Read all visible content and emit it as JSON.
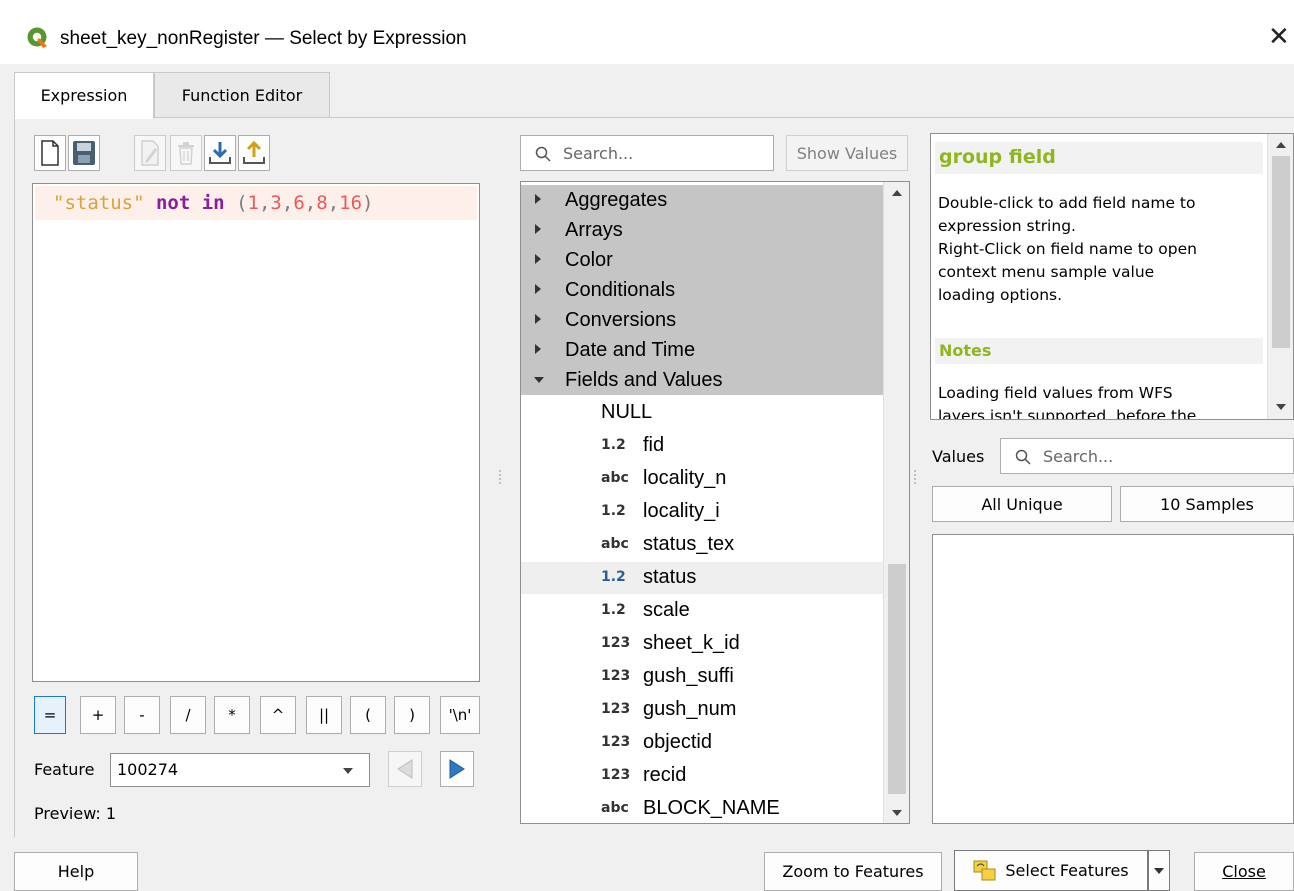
{
  "window": {
    "title": "sheet_key_nonRegister — Select by Expression",
    "close_glyph": "✕"
  },
  "tabs": [
    {
      "label": "Expression",
      "active": true
    },
    {
      "label": "Function Editor",
      "active": false
    }
  ],
  "toolbar": {
    "icons": [
      "new-file-icon",
      "save-icon",
      "edit-icon",
      "delete-icon",
      "import-icon",
      "export-icon"
    ]
  },
  "editor": {
    "expression": {
      "field": "\"status\"",
      "keyword": "not in",
      "paren_open": "(",
      "values": [
        "1",
        "3",
        "6",
        "8",
        "16"
      ],
      "comma": ",",
      "paren_close": ")"
    }
  },
  "operators": [
    "=",
    "+",
    "-",
    "/",
    "*",
    "^",
    "||",
    "(",
    ")",
    "'\\n'"
  ],
  "feature": {
    "label": "Feature",
    "value": "100274"
  },
  "preview": {
    "text": "Preview: 1"
  },
  "search": {
    "placeholder": "Search...",
    "show_values_label": "Show Values"
  },
  "function_tree": {
    "groups": [
      {
        "label": "Aggregates",
        "expanded": false
      },
      {
        "label": "Arrays",
        "expanded": false
      },
      {
        "label": "Color",
        "expanded": false
      },
      {
        "label": "Conditionals",
        "expanded": false
      },
      {
        "label": "Conversions",
        "expanded": false
      },
      {
        "label": "Date and Time",
        "expanded": false
      },
      {
        "label": "Fields and Values",
        "expanded": true
      }
    ],
    "fields": [
      {
        "type": "",
        "name": "NULL"
      },
      {
        "type": "1.2",
        "name": "fid"
      },
      {
        "type": "abc",
        "name": "locality_n"
      },
      {
        "type": "1.2",
        "name": "locality_i"
      },
      {
        "type": "abc",
        "name": "status_tex"
      },
      {
        "type": "1.2",
        "name": "status",
        "selected": true
      },
      {
        "type": "1.2",
        "name": "scale"
      },
      {
        "type": "123",
        "name": "sheet_k_id"
      },
      {
        "type": "123",
        "name": "gush_suffi"
      },
      {
        "type": "123",
        "name": "gush_num"
      },
      {
        "type": "123",
        "name": "objectid"
      },
      {
        "type": "123",
        "name": "recid"
      },
      {
        "type": "abc",
        "name": "BLOCK_NAME"
      }
    ]
  },
  "help": {
    "title": "group field",
    "body": [
      "Double-click to add field name to",
      "expression string.",
      "Right-Click on field name to open",
      "context menu sample value",
      "loading options."
    ],
    "notes_heading": "Notes",
    "notes_body": [
      "Loading field values from WFS",
      "layers isn't supported, before the"
    ]
  },
  "values": {
    "label": "Values",
    "search_placeholder": "Search...",
    "all_unique_label": "All Unique",
    "samples_label": "10 Samples"
  },
  "footer": {
    "help_label": "Help",
    "zoom_label": "Zoom to Features",
    "select_label": "Select Features",
    "close_label": "Close"
  },
  "colors": {
    "qgis_green": "#8fb51f",
    "field_string": "#d9a23c",
    "keyword": "#8a1f9c",
    "number": "#ea5a5a",
    "group_bg": "#c5c5c5"
  }
}
